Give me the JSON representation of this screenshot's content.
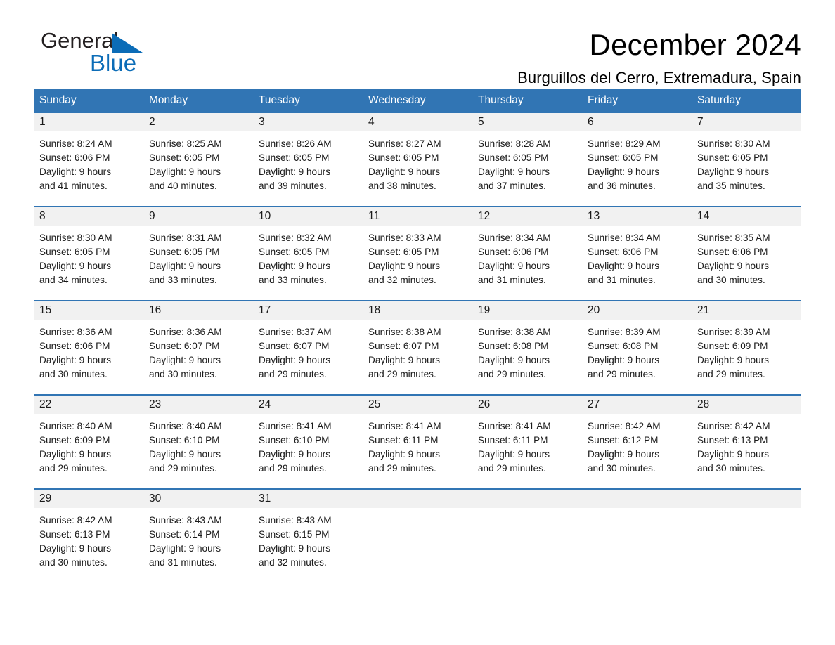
{
  "brand": {
    "name_part1": "General",
    "name_part2": "Blue",
    "accent_color": "#0b6cb7"
  },
  "header": {
    "title": "December 2024",
    "location": "Burguillos del Cerro, Extremadura, Spain"
  },
  "calendar": {
    "header_bg": "#3175b4",
    "daynum_bg": "#f1f1f1",
    "weekday_headers": [
      "Sunday",
      "Monday",
      "Tuesday",
      "Wednesday",
      "Thursday",
      "Friday",
      "Saturday"
    ],
    "weeks": [
      [
        {
          "day": "1",
          "sunrise": "Sunrise: 8:24 AM",
          "sunset": "Sunset: 6:06 PM",
          "daylight_line1": "Daylight: 9 hours",
          "daylight_line2": "and 41 minutes."
        },
        {
          "day": "2",
          "sunrise": "Sunrise: 8:25 AM",
          "sunset": "Sunset: 6:05 PM",
          "daylight_line1": "Daylight: 9 hours",
          "daylight_line2": "and 40 minutes."
        },
        {
          "day": "3",
          "sunrise": "Sunrise: 8:26 AM",
          "sunset": "Sunset: 6:05 PM",
          "daylight_line1": "Daylight: 9 hours",
          "daylight_line2": "and 39 minutes."
        },
        {
          "day": "4",
          "sunrise": "Sunrise: 8:27 AM",
          "sunset": "Sunset: 6:05 PM",
          "daylight_line1": "Daylight: 9 hours",
          "daylight_line2": "and 38 minutes."
        },
        {
          "day": "5",
          "sunrise": "Sunrise: 8:28 AM",
          "sunset": "Sunset: 6:05 PM",
          "daylight_line1": "Daylight: 9 hours",
          "daylight_line2": "and 37 minutes."
        },
        {
          "day": "6",
          "sunrise": "Sunrise: 8:29 AM",
          "sunset": "Sunset: 6:05 PM",
          "daylight_line1": "Daylight: 9 hours",
          "daylight_line2": "and 36 minutes."
        },
        {
          "day": "7",
          "sunrise": "Sunrise: 8:30 AM",
          "sunset": "Sunset: 6:05 PM",
          "daylight_line1": "Daylight: 9 hours",
          "daylight_line2": "and 35 minutes."
        }
      ],
      [
        {
          "day": "8",
          "sunrise": "Sunrise: 8:30 AM",
          "sunset": "Sunset: 6:05 PM",
          "daylight_line1": "Daylight: 9 hours",
          "daylight_line2": "and 34 minutes."
        },
        {
          "day": "9",
          "sunrise": "Sunrise: 8:31 AM",
          "sunset": "Sunset: 6:05 PM",
          "daylight_line1": "Daylight: 9 hours",
          "daylight_line2": "and 33 minutes."
        },
        {
          "day": "10",
          "sunrise": "Sunrise: 8:32 AM",
          "sunset": "Sunset: 6:05 PM",
          "daylight_line1": "Daylight: 9 hours",
          "daylight_line2": "and 33 minutes."
        },
        {
          "day": "11",
          "sunrise": "Sunrise: 8:33 AM",
          "sunset": "Sunset: 6:05 PM",
          "daylight_line1": "Daylight: 9 hours",
          "daylight_line2": "and 32 minutes."
        },
        {
          "day": "12",
          "sunrise": "Sunrise: 8:34 AM",
          "sunset": "Sunset: 6:06 PM",
          "daylight_line1": "Daylight: 9 hours",
          "daylight_line2": "and 31 minutes."
        },
        {
          "day": "13",
          "sunrise": "Sunrise: 8:34 AM",
          "sunset": "Sunset: 6:06 PM",
          "daylight_line1": "Daylight: 9 hours",
          "daylight_line2": "and 31 minutes."
        },
        {
          "day": "14",
          "sunrise": "Sunrise: 8:35 AM",
          "sunset": "Sunset: 6:06 PM",
          "daylight_line1": "Daylight: 9 hours",
          "daylight_line2": "and 30 minutes."
        }
      ],
      [
        {
          "day": "15",
          "sunrise": "Sunrise: 8:36 AM",
          "sunset": "Sunset: 6:06 PM",
          "daylight_line1": "Daylight: 9 hours",
          "daylight_line2": "and 30 minutes."
        },
        {
          "day": "16",
          "sunrise": "Sunrise: 8:36 AM",
          "sunset": "Sunset: 6:07 PM",
          "daylight_line1": "Daylight: 9 hours",
          "daylight_line2": "and 30 minutes."
        },
        {
          "day": "17",
          "sunrise": "Sunrise: 8:37 AM",
          "sunset": "Sunset: 6:07 PM",
          "daylight_line1": "Daylight: 9 hours",
          "daylight_line2": "and 29 minutes."
        },
        {
          "day": "18",
          "sunrise": "Sunrise: 8:38 AM",
          "sunset": "Sunset: 6:07 PM",
          "daylight_line1": "Daylight: 9 hours",
          "daylight_line2": "and 29 minutes."
        },
        {
          "day": "19",
          "sunrise": "Sunrise: 8:38 AM",
          "sunset": "Sunset: 6:08 PM",
          "daylight_line1": "Daylight: 9 hours",
          "daylight_line2": "and 29 minutes."
        },
        {
          "day": "20",
          "sunrise": "Sunrise: 8:39 AM",
          "sunset": "Sunset: 6:08 PM",
          "daylight_line1": "Daylight: 9 hours",
          "daylight_line2": "and 29 minutes."
        },
        {
          "day": "21",
          "sunrise": "Sunrise: 8:39 AM",
          "sunset": "Sunset: 6:09 PM",
          "daylight_line1": "Daylight: 9 hours",
          "daylight_line2": "and 29 minutes."
        }
      ],
      [
        {
          "day": "22",
          "sunrise": "Sunrise: 8:40 AM",
          "sunset": "Sunset: 6:09 PM",
          "daylight_line1": "Daylight: 9 hours",
          "daylight_line2": "and 29 minutes."
        },
        {
          "day": "23",
          "sunrise": "Sunrise: 8:40 AM",
          "sunset": "Sunset: 6:10 PM",
          "daylight_line1": "Daylight: 9 hours",
          "daylight_line2": "and 29 minutes."
        },
        {
          "day": "24",
          "sunrise": "Sunrise: 8:41 AM",
          "sunset": "Sunset: 6:10 PM",
          "daylight_line1": "Daylight: 9 hours",
          "daylight_line2": "and 29 minutes."
        },
        {
          "day": "25",
          "sunrise": "Sunrise: 8:41 AM",
          "sunset": "Sunset: 6:11 PM",
          "daylight_line1": "Daylight: 9 hours",
          "daylight_line2": "and 29 minutes."
        },
        {
          "day": "26",
          "sunrise": "Sunrise: 8:41 AM",
          "sunset": "Sunset: 6:11 PM",
          "daylight_line1": "Daylight: 9 hours",
          "daylight_line2": "and 29 minutes."
        },
        {
          "day": "27",
          "sunrise": "Sunrise: 8:42 AM",
          "sunset": "Sunset: 6:12 PM",
          "daylight_line1": "Daylight: 9 hours",
          "daylight_line2": "and 30 minutes."
        },
        {
          "day": "28",
          "sunrise": "Sunrise: 8:42 AM",
          "sunset": "Sunset: 6:13 PM",
          "daylight_line1": "Daylight: 9 hours",
          "daylight_line2": "and 30 minutes."
        }
      ],
      [
        {
          "day": "29",
          "sunrise": "Sunrise: 8:42 AM",
          "sunset": "Sunset: 6:13 PM",
          "daylight_line1": "Daylight: 9 hours",
          "daylight_line2": "and 30 minutes."
        },
        {
          "day": "30",
          "sunrise": "Sunrise: 8:43 AM",
          "sunset": "Sunset: 6:14 PM",
          "daylight_line1": "Daylight: 9 hours",
          "daylight_line2": "and 31 minutes."
        },
        {
          "day": "31",
          "sunrise": "Sunrise: 8:43 AM",
          "sunset": "Sunset: 6:15 PM",
          "daylight_line1": "Daylight: 9 hours",
          "daylight_line2": "and 32 minutes."
        },
        {
          "day": "",
          "sunrise": "",
          "sunset": "",
          "daylight_line1": "",
          "daylight_line2": ""
        },
        {
          "day": "",
          "sunrise": "",
          "sunset": "",
          "daylight_line1": "",
          "daylight_line2": ""
        },
        {
          "day": "",
          "sunrise": "",
          "sunset": "",
          "daylight_line1": "",
          "daylight_line2": ""
        },
        {
          "day": "",
          "sunrise": "",
          "sunset": "",
          "daylight_line1": "",
          "daylight_line2": ""
        }
      ]
    ]
  }
}
